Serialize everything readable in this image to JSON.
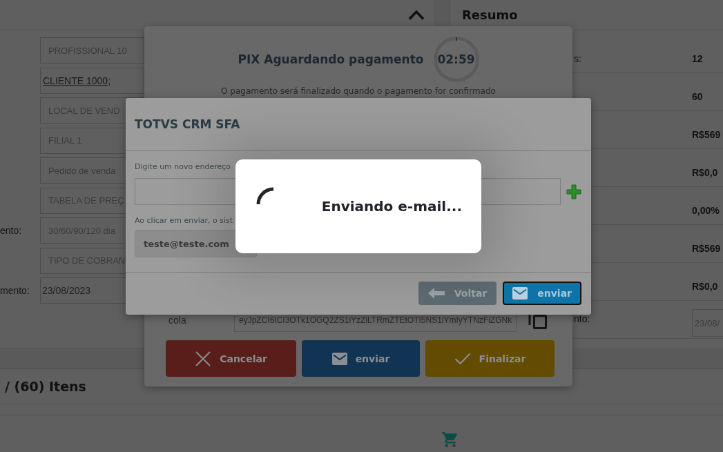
{
  "left_panel": {
    "rows": [
      {
        "kind": "text",
        "value": "PROFISSIONAL 10"
      },
      {
        "kind": "link",
        "value": "CLIENTE 1000;"
      },
      {
        "kind": "text",
        "value": "LOCAL DE VEND"
      },
      {
        "kind": "text",
        "value": "FILIAL 1"
      },
      {
        "kind": "text",
        "value": "Pedido de venda"
      },
      {
        "kind": "text",
        "value": "TABELA DE PREÇ"
      },
      {
        "kind": "text",
        "label": "ento:",
        "value": "30/60/90/120 dia"
      },
      {
        "kind": "text",
        "value": "TIPO DE COBRAN"
      },
      {
        "kind": "date",
        "label": "mento:",
        "value": "23/08/2023"
      }
    ]
  },
  "summary": {
    "title": "Resumo",
    "rows": [
      {
        "kind": "value",
        "label": "s:",
        "value": "12"
      },
      {
        "kind": "value",
        "value": "60"
      },
      {
        "kind": "value",
        "value": "R$569"
      },
      {
        "kind": "value",
        "value": "R$0,0"
      },
      {
        "kind": "value",
        "value": "0,00%"
      },
      {
        "kind": "value",
        "value": "R$569"
      },
      {
        "kind": "value",
        "value": "R$0,0"
      },
      {
        "kind": "date",
        "label": "nto:",
        "value": "23/08/"
      }
    ]
  },
  "items_section": {
    "title": "/ (60) Itens"
  },
  "pix_dialog": {
    "title": "PIX Aguardando pagamento",
    "timer": "02:59",
    "message": "O pagamento será finalizado quando o pagamento for confirmado",
    "code_label": "cola",
    "code_value": "eyJpZCI6ICI3OTk1OGQ2ZS1iYzZiLTRmZTEtOTI5NS1iYmIyYTNzFiZGNk",
    "buttons": [
      {
        "kind": "cancel",
        "label": "Cancelar"
      },
      {
        "kind": "send",
        "label": "enviar"
      },
      {
        "kind": "finish",
        "label": "Finalizar"
      }
    ]
  },
  "email_dialog": {
    "title": "TOTVS CRM SFA",
    "new_address_label": "Digite um novo endereço",
    "hint": "Ao clicar em enviar, o sist",
    "emails": [
      "teste@teste.com"
    ],
    "buttons": [
      {
        "kind": "back",
        "label": "Voltar",
        "focused": false
      },
      {
        "kind": "send",
        "label": "enviar",
        "focused": true
      }
    ]
  },
  "loading_dialog": {
    "message": "Enviando e-mail..."
  }
}
